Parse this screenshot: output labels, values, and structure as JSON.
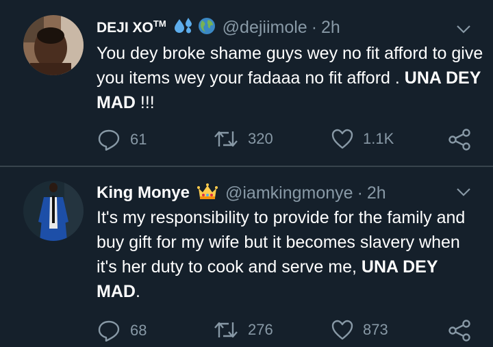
{
  "tweets": [
    {
      "name": "DEJI XO",
      "name_sup": "TM",
      "badges": [
        "droplets-emoji",
        "globe-emoji"
      ],
      "handle": "@dejiimole",
      "separator": "·",
      "time": "2h",
      "text_plain": "You dey broke shame guys wey no fit afford to give you items wey your fadaaa no fit afford . ",
      "text_bold": "UNA DEY MAD",
      "text_tail": " !!!",
      "replies": "61",
      "retweets": "320",
      "likes": "1.1K"
    },
    {
      "name": "King Monye",
      "badges": [
        "crown-emoji"
      ],
      "handle": "@iamkingmonye",
      "separator": "·",
      "time": "2h",
      "text_plain": "It's my responsibility to provide for the family and buy gift for my wife but it becomes slavery when it's her duty to cook and serve me, ",
      "text_bold": "UNA DEY MAD",
      "text_tail": ".",
      "replies": "68",
      "retweets": "276",
      "likes": "873"
    }
  ],
  "colors": {
    "background": "#15202b",
    "muted": "#8899a6",
    "divider": "#38444d",
    "text": "#ffffff"
  }
}
